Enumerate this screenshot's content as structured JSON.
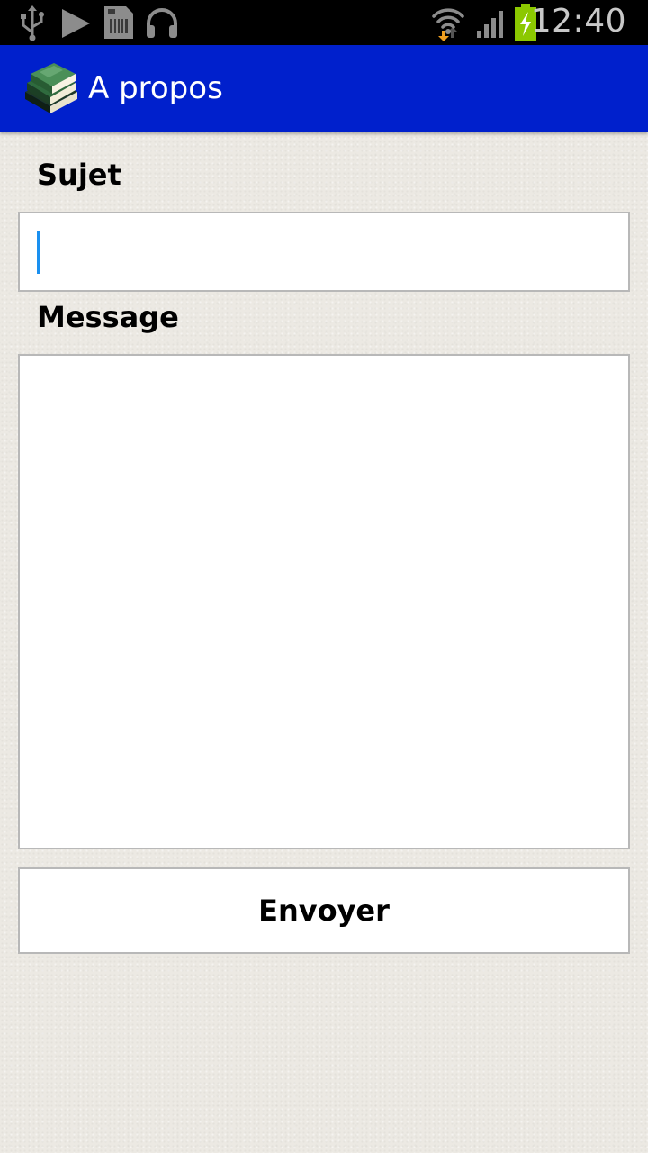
{
  "status_bar": {
    "time": "12:40",
    "icons": [
      "usb-icon",
      "play-store-icon",
      "sd-card-icon",
      "headphones-icon",
      "wifi-icon",
      "signal-icon",
      "battery-charging-icon"
    ],
    "colors": {
      "background": "#000000",
      "icon": "#8c8c8c",
      "battery": "#8cc800"
    }
  },
  "action_bar": {
    "title": "A propos",
    "logo": "books-logo",
    "color": "#0020cc"
  },
  "form": {
    "subject_label": "Sujet",
    "subject_value": "",
    "message_label": "Message",
    "message_value": "",
    "send_label": "Envoyer",
    "accent": "#1a90f0"
  }
}
